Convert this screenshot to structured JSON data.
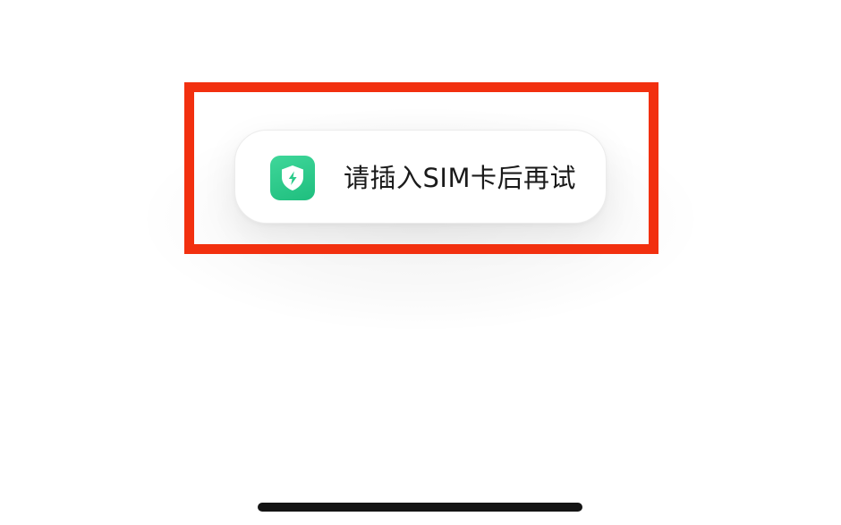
{
  "toast": {
    "message": "请插入SIM卡后再试",
    "icon": "shield-lightning-icon",
    "icon_color": "#2bcb8a"
  },
  "highlight": {
    "color": "#f2300f"
  },
  "system": {
    "home_indicator": "home-indicator-bar"
  }
}
